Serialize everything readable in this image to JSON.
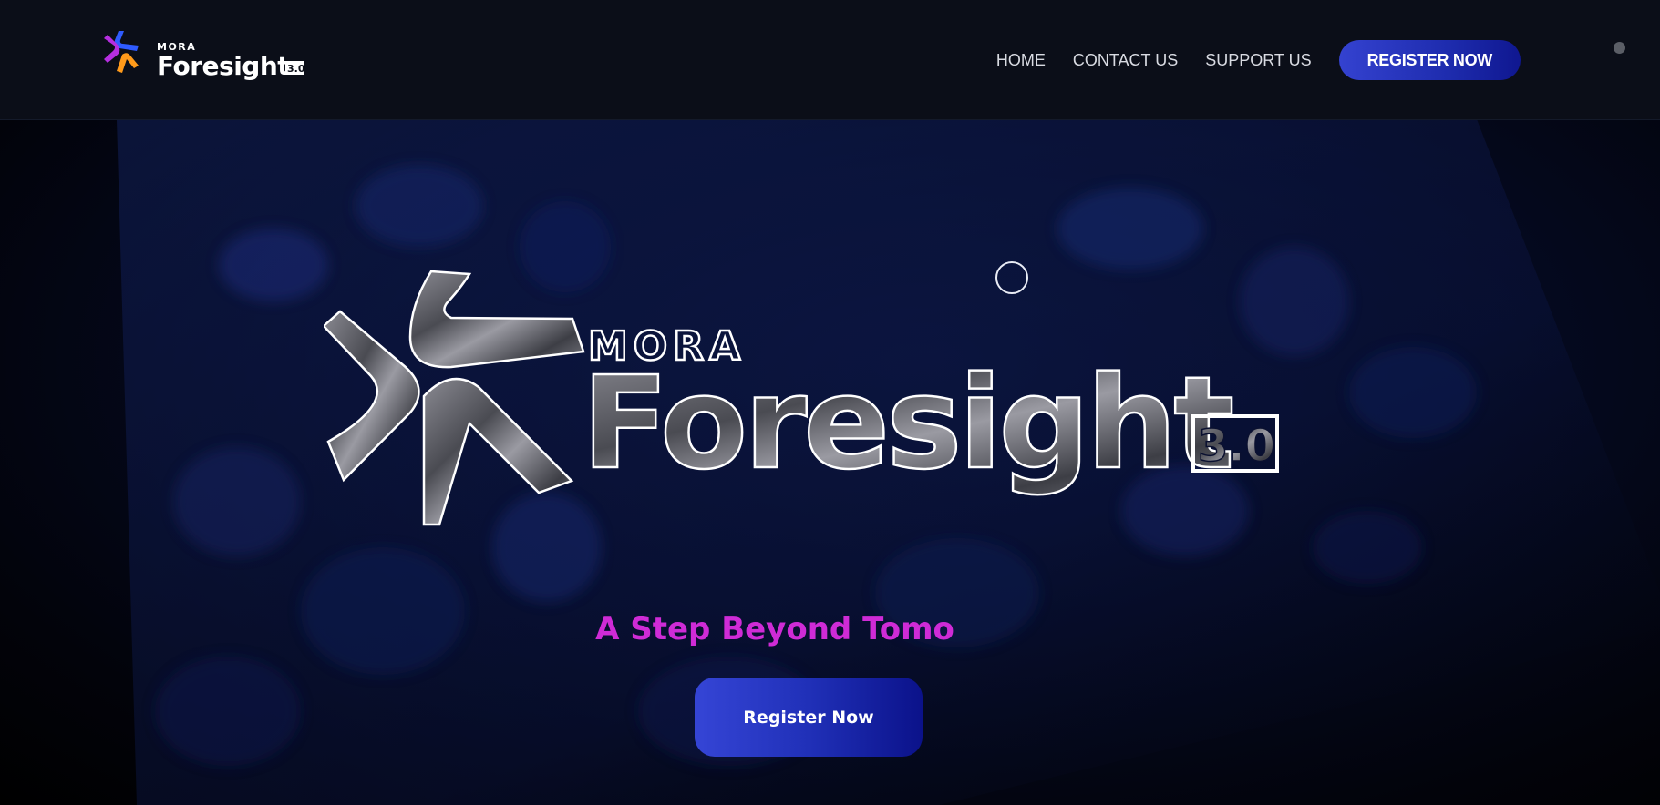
{
  "header": {
    "brand": {
      "top_word": "MORA",
      "main_word": "Foresight",
      "version": "3.0"
    },
    "nav": {
      "home": "HOME",
      "contact": "CONTACT US",
      "support": "SUPPORT US",
      "register": "REGISTER NOW"
    }
  },
  "hero": {
    "logo": {
      "top_word": "MORA",
      "main_word": "Foresight",
      "version": "3.0"
    },
    "tagline": "A Step Beyond Tomo",
    "cta_label": "Register Now"
  },
  "colors": {
    "header_bg": "#0b0e18",
    "accent_blue": "#2a38c8",
    "tagline_magenta": "#cf2bd6",
    "logo_blue": "#2f5bff",
    "logo_purple": "#b62ee0",
    "logo_orange": "#ff9a1a"
  },
  "icons": [
    "mora-foresight-logo",
    "star-burst-icon",
    "cursor-ring-icon",
    "scroll-indicator-dot"
  ]
}
